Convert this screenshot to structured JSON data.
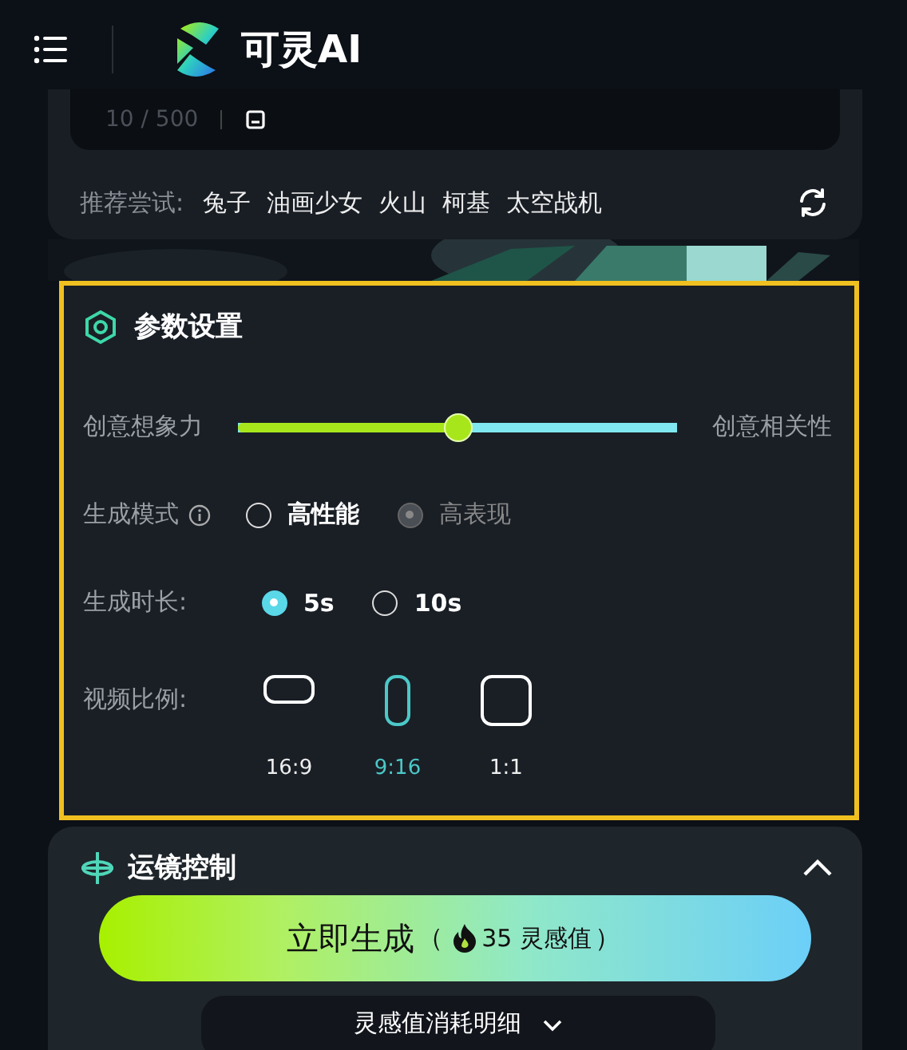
{
  "header": {
    "app_name": "可灵AI"
  },
  "prompt": {
    "counter": "10 / 500"
  },
  "suggestions": {
    "label": "推荐尝试:",
    "items": [
      "兔子",
      "油画少女",
      "火山",
      "柯基",
      "太空战机"
    ]
  },
  "params": {
    "title": "参数设置",
    "highlighted": true,
    "slider": {
      "left_label": "创意想象力",
      "right_label": "创意相关性",
      "level": 0.5
    },
    "mode": {
      "label": "生成模式",
      "options": [
        {
          "label": "高性能",
          "selected": false,
          "disabled": false
        },
        {
          "label": "高表现",
          "selected": true,
          "disabled": true
        }
      ]
    },
    "duration": {
      "label": "生成时长:",
      "options": [
        {
          "label": "5s",
          "selected": true,
          "disabled": false
        },
        {
          "label": "10s",
          "selected": false,
          "disabled": false
        }
      ]
    },
    "ratio": {
      "label": "视频比例:",
      "options": [
        {
          "label": "16:9",
          "kind": "wide",
          "selected": false
        },
        {
          "label": "9:16",
          "kind": "tall",
          "selected": true
        },
        {
          "label": "1:1",
          "kind": "square",
          "selected": false
        }
      ]
    }
  },
  "camera": {
    "title": "运镜控制",
    "expanded": true
  },
  "generate": {
    "label": "立即生成",
    "cost_open": "（",
    "cost": "35 灵感值",
    "cost_close": "）"
  },
  "details": {
    "label": "灵感值消耗明细",
    "expanded": false
  }
}
